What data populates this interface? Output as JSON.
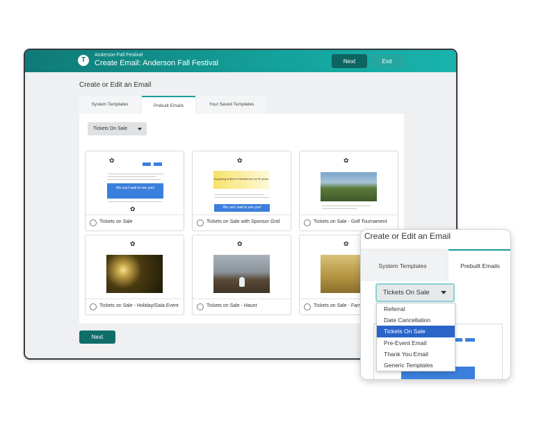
{
  "header": {
    "org_name": "Anderson Fall Festival",
    "title": "Create Email: Anderson Fall Festival",
    "logo_letter": "T",
    "next_label": "Next",
    "exit_label": "Exit"
  },
  "section_title": "Create or Edit an Email",
  "tabs": [
    {
      "label": "System Templates",
      "active": false
    },
    {
      "label": "Prebuilt Emails",
      "active": true
    },
    {
      "label": "Your Saved Templates",
      "active": false
    }
  ],
  "filter": {
    "selected": "Tickets On Sale"
  },
  "templates": [
    {
      "label": "Tickets on Sale"
    },
    {
      "label": "Tickets on Sale with Sponsor Grid"
    },
    {
      "label": "Tickets on Sale - Golf Tournament"
    },
    {
      "label": "Tickets on Sale - Holiday/Gala Event"
    },
    {
      "label": "Tickets on Sale - Haunt"
    },
    {
      "label": "Tickets on Sale - Farm"
    }
  ],
  "preview_text": {
    "banner_1": "We can't wait to see you!",
    "banner_2": "We can't wait to see you!",
    "sponsor_blurb": "Supplying smiles to Northerners for 50 years"
  },
  "bottom_next_label": "Next",
  "zoom": {
    "title": "Create or Edit an Email",
    "tab1": "System Templates",
    "tab2": "Prebuilt Emails",
    "selected": "Tickets On Sale",
    "options": [
      "Referral",
      "Date Cancellation",
      "Tickets On Sale",
      "Pre-Event Email",
      "Thank You Email",
      "Generic Templates"
    ]
  },
  "colors": {
    "brand_teal": "#0f7a77",
    "accent_teal": "#1a9e96",
    "link_blue": "#3b7fdc",
    "selected_blue": "#2a64c9"
  }
}
